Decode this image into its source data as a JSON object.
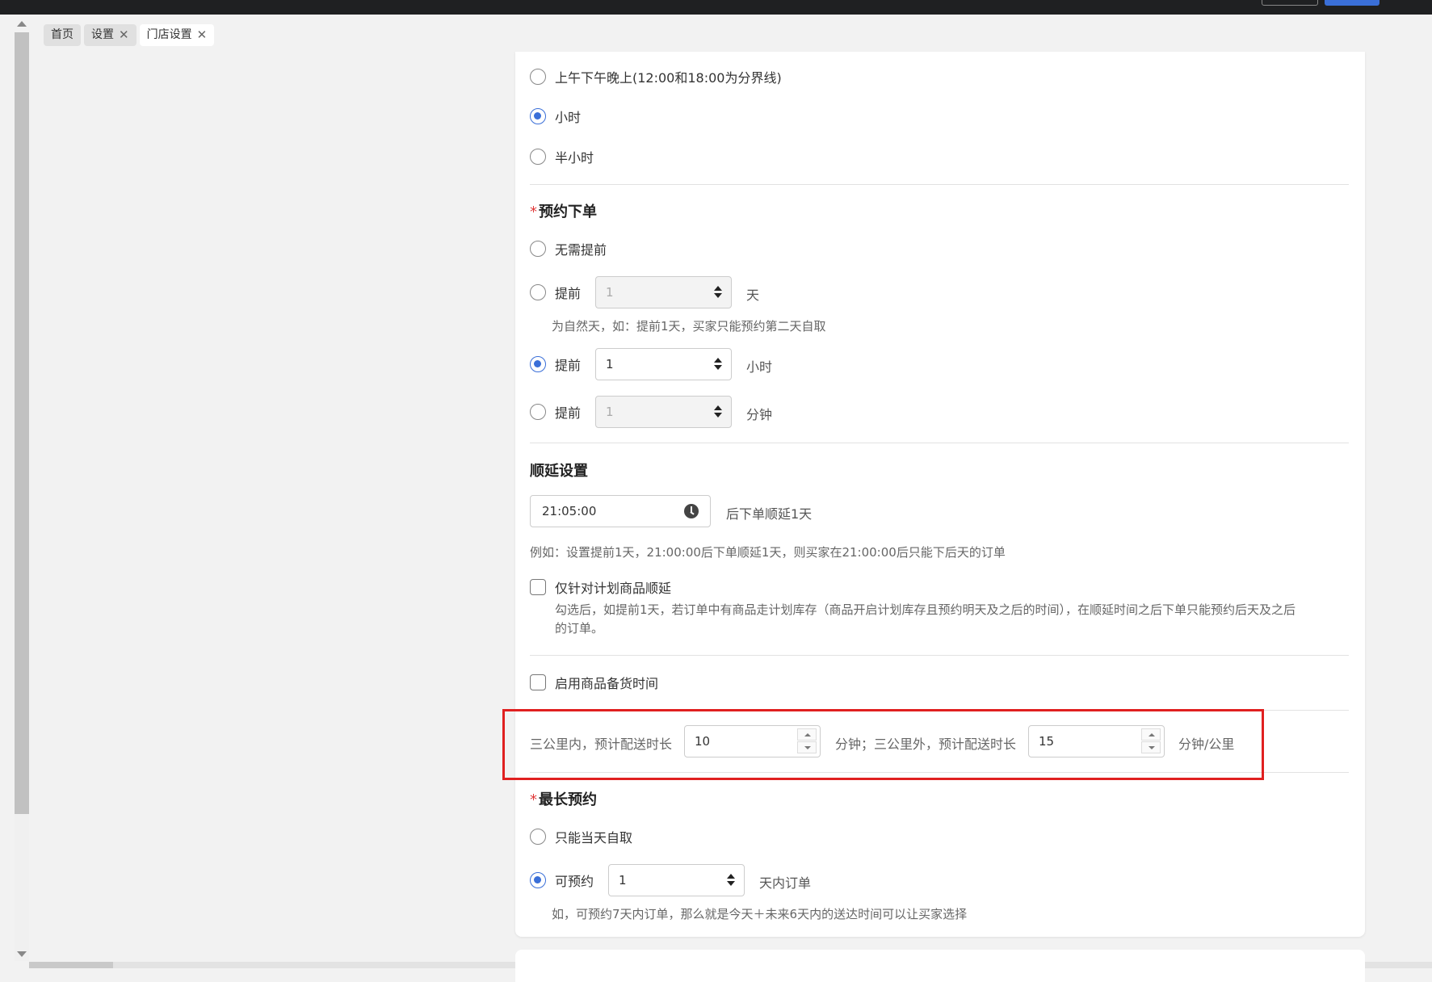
{
  "tabs": [
    {
      "label": "首页",
      "closable": false
    },
    {
      "label": "设置",
      "closable": true
    },
    {
      "label": "门店设置",
      "closable": true,
      "active": true
    }
  ],
  "time_division": {
    "options": [
      {
        "label": "上午下午晚上(12:00和18:00为分界线)",
        "checked": false
      },
      {
        "label": "小时",
        "checked": true
      },
      {
        "label": "半小时",
        "checked": false
      }
    ]
  },
  "reservation": {
    "title": "预约下单",
    "required_mark": "*",
    "no_advance": "无需提前",
    "advance_label": "提前",
    "advance_days": {
      "value": "1",
      "unit": "天",
      "checked": false,
      "disabled": true
    },
    "days_hint": "为自然天，如：提前1天，买家只能预约第二天自取",
    "advance_hours": {
      "value": "1",
      "unit": "小时",
      "checked": true,
      "disabled": false
    },
    "advance_minutes": {
      "value": "1",
      "unit": "分钟",
      "checked": false,
      "disabled": true
    }
  },
  "postpone": {
    "title": "顺延设置",
    "time_value": "21:05:00",
    "time_suffix": "后下单顺延1天",
    "example": "例如：设置提前1天，21:00:00后下单顺延1天，则买家在21:00:00后只能下后天的订单",
    "plan_only_label": "仅针对计划商品顺延",
    "plan_only_desc_line1": "勾选后，如提前1天，若订单中有商品走计划库存（商品开启计划库存且预约明天及之后的时间），在顺延时间之后下单只能预约后天及之后",
    "plan_only_desc_line2": "的订单。"
  },
  "stock_prep": {
    "label": "启用商品备货时间"
  },
  "delivery": {
    "within_label": "三公里内，预计配送时长",
    "within_value": "10",
    "middle_label": "分钟；三公里外，预计配送时长",
    "outside_value": "15",
    "unit_label": "分钟/公里"
  },
  "max_reservation": {
    "title": "最长预约",
    "required_mark": "*",
    "same_day": "只能当天自取",
    "can_reserve": "可预约",
    "days_value": "1",
    "days_suffix": "天内订单",
    "hint": "如，可预约7天内订单，那么就是今天＋未来6天内的送达时间可以让买家选择"
  },
  "colors": {
    "primary": "#3a6fd8",
    "highlight_border": "#e02020",
    "required": "#e03a3a"
  }
}
